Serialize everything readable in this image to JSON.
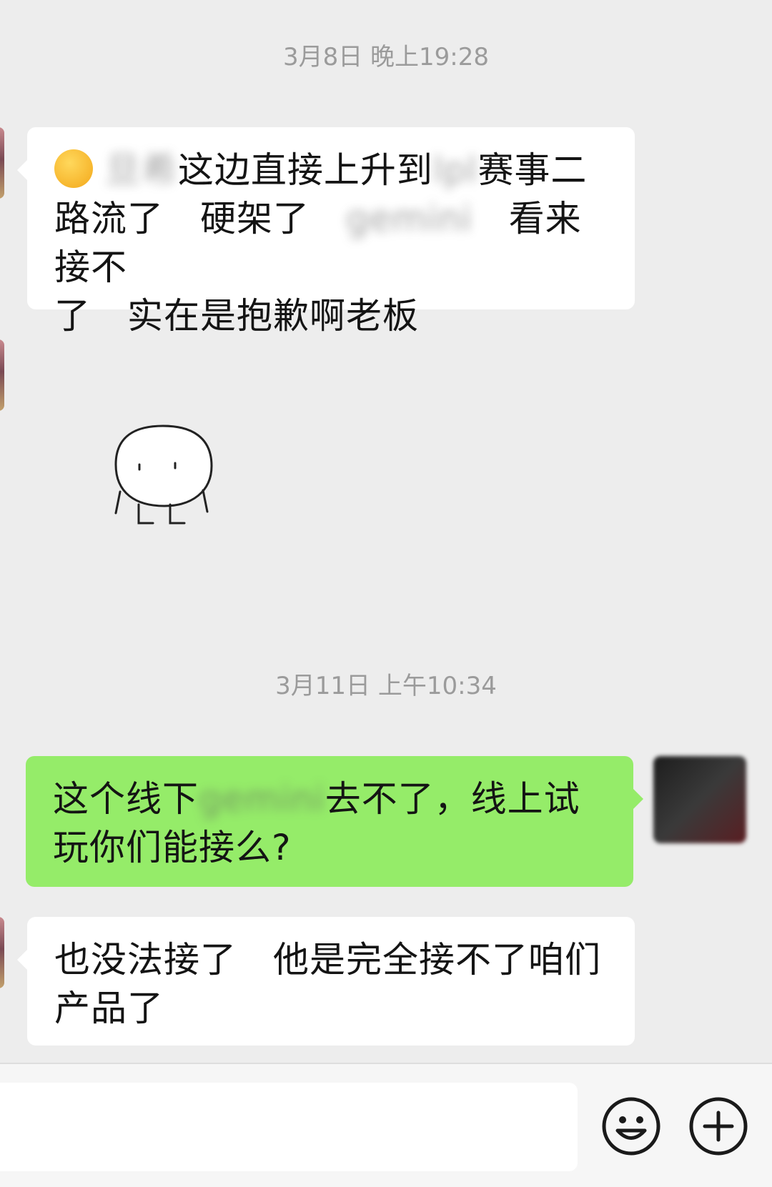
{
  "timestamps": [
    "3月8日 晚上19:28",
    "3月11日 上午10:34"
  ],
  "messages": [
    {
      "sender": "other",
      "emoji": "face-with-tears-of-joy",
      "line1_a": "这边直接上升到",
      "line1_blur1": "旦希",
      "line1_blur2": "lpl",
      "line1_b": "赛事二",
      "line2_a": "路流了　硬架了",
      "line2_blur": "gemini",
      "line2_b": "看来接不",
      "line3": "了　实在是抱歉啊老板"
    },
    {
      "sender": "me",
      "line1_a": "这个线下",
      "line1_blur": "gemini",
      "line1_b": "去不了，线上试",
      "line2": "玩你们能接么?"
    },
    {
      "sender": "other",
      "line1": "也没法接了　他是完全接不了咱们",
      "line2": "产品了"
    }
  ],
  "sticker": "blob-character-sticker",
  "toolbar": {
    "emoji_icon": "smiley-icon",
    "plus_icon": "plus-circle-icon"
  }
}
